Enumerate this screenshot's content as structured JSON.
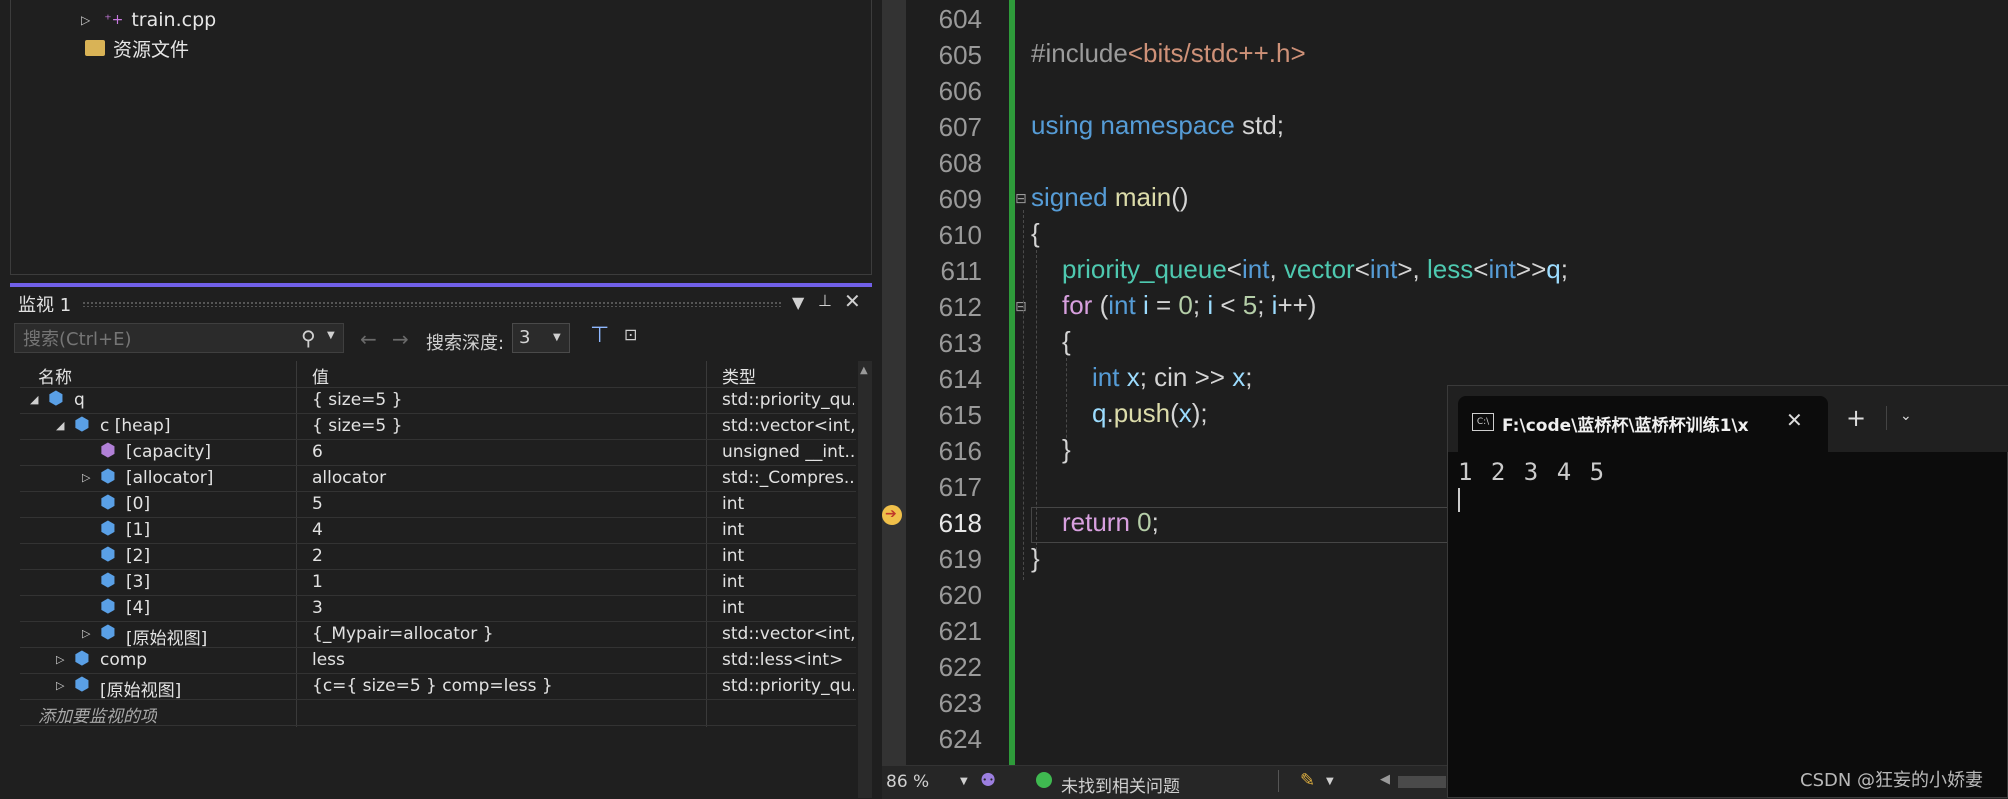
{
  "solution_explorer": {
    "items": [
      {
        "label": "train.cpp"
      },
      {
        "label": "资源文件"
      }
    ]
  },
  "watch": {
    "title": "监视 1",
    "search_placeholder": "搜索(Ctrl+E)",
    "depth_label": "搜索深度:",
    "depth_value": "3",
    "columns": [
      "名称",
      "值",
      "类型"
    ],
    "rows": [
      {
        "name": "q",
        "value": "{ size=5 }",
        "type": "std::priority_qu..."
      },
      {
        "name": "c [heap]",
        "value": "{ size=5 }",
        "type": "std::vector<int,..."
      },
      {
        "name": "[capacity]",
        "value": "6",
        "type": "unsigned __int..."
      },
      {
        "name": "[allocator]",
        "value": "allocator",
        "type": "std::_Compres..."
      },
      {
        "name": "[0]",
        "value": "5",
        "type": "int"
      },
      {
        "name": "[1]",
        "value": "4",
        "type": "int"
      },
      {
        "name": "[2]",
        "value": "2",
        "type": "int"
      },
      {
        "name": "[3]",
        "value": "1",
        "type": "int"
      },
      {
        "name": "[4]",
        "value": "3",
        "type": "int"
      },
      {
        "name": "[原始视图]",
        "value": "{_Mypair=allocator }",
        "type": "std::vector<int,..."
      },
      {
        "name": "comp",
        "value": "less",
        "type": "std::less<int>"
      },
      {
        "name": "[原始视图]",
        "value": "{c={ size=5 } comp=less }",
        "type": "std::priority_qu..."
      }
    ],
    "add_item_placeholder": "添加要监视的项"
  },
  "editor": {
    "line_numbers": [
      "604",
      "605",
      "606",
      "607",
      "608",
      "609",
      "610",
      "611",
      "612",
      "613",
      "614",
      "615",
      "616",
      "617",
      "618",
      "619",
      "620",
      "621",
      "622",
      "623",
      "624"
    ],
    "current_line": "618",
    "status": {
      "zoom": "86 %",
      "issues": "未找到相关问题"
    }
  },
  "terminal": {
    "tab_title": "F:\\code\\蓝桥杯\\蓝桥杯训练1\\x",
    "output": "1 2 3 4 5"
  },
  "watermark": "CSDN @狂妄的小娇妻",
  "colors": {
    "accent": "#7160e8",
    "gutter_green": "#2e9b3a",
    "keyword": "#569cd6",
    "type": "#4ec9b0"
  }
}
